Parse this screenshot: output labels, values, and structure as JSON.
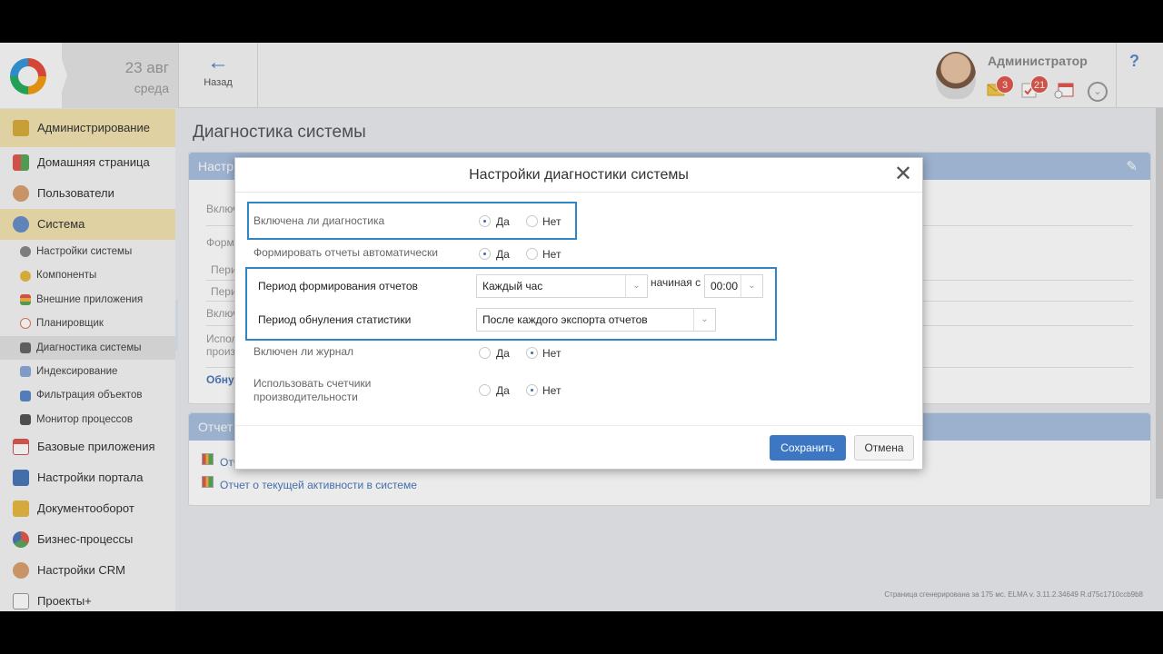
{
  "header": {
    "date_day": "23 авг",
    "date_weekday": "среда",
    "back_label": "Назад",
    "user_name": "Администратор",
    "mail_count": "3",
    "tasks_count": "21",
    "help_label": "?"
  },
  "sidebar": {
    "sections": [
      {
        "label": "Администрирование",
        "icon": "lock-icon"
      },
      {
        "label": "Домашняя страница",
        "icon": "home-icon"
      },
      {
        "label": "Пользователи",
        "icon": "users-icon"
      },
      {
        "label": "Система",
        "icon": "system-icon"
      }
    ],
    "sub_items": [
      {
        "label": "Настройки системы",
        "icon": "gear-icon"
      },
      {
        "label": "Компоненты",
        "icon": "component-icon"
      },
      {
        "label": "Внешние приложения",
        "icon": "apps-icon"
      },
      {
        "label": "Планировщик",
        "icon": "clock-icon"
      },
      {
        "label": "Диагностика системы",
        "icon": "diagnostics-icon"
      },
      {
        "label": "Индексирование",
        "icon": "index-icon"
      },
      {
        "label": "Фильтрация объектов",
        "icon": "filter-icon"
      },
      {
        "label": "Монитор процессов",
        "icon": "monitor-icon"
      }
    ],
    "bottom_items": [
      {
        "label": "Базовые приложения",
        "icon": "calendar-icon"
      },
      {
        "label": "Настройки портала",
        "icon": "portal-icon"
      },
      {
        "label": "Документооборот",
        "icon": "documents-icon"
      },
      {
        "label": "Бизнес-процессы",
        "icon": "process-icon"
      },
      {
        "label": "Настройки CRM",
        "icon": "crm-icon"
      },
      {
        "label": "Проекты+",
        "icon": "projects-icon"
      }
    ]
  },
  "main": {
    "page_title": "Диагностика системы",
    "panel1_head": "Настр",
    "panel2_head": "Отчет",
    "bg_labels": [
      "Включ",
      "Форми",
      "Перио",
      "Перио",
      "Включ",
      "Испол",
      "произ"
    ],
    "bg_link": "Обнул",
    "report_link_1": "Отч",
    "report_link_2": "Отчет о текущей активности в системе",
    "footer": "Страница сгенерирована за 175 мс. ELMA v. 3.11.2.34649 R.d75c1710ccb9b8"
  },
  "modal": {
    "title": "Настройки диагностики системы",
    "close_label": "✕",
    "yes": "Да",
    "no": "Нет",
    "rows": {
      "diag_enabled": "Включена ли диагностика",
      "auto_reports": "Формировать отчеты автоматически",
      "report_period": "Период формирования отчетов",
      "reset_period": "Период обнуления статистики",
      "journal_enabled": "Включен ли журнал",
      "perf_counters": "Использовать счетчики производительности"
    },
    "report_period_value": "Каждый час",
    "starting_from": "начиная с",
    "time_value": "00:00",
    "reset_period_value": "После каждого экспорта отчетов",
    "save_label": "Сохранить",
    "cancel_label": "Отмена",
    "selections": {
      "diag_enabled": "yes",
      "auto_reports": "yes",
      "journal_enabled": "no",
      "perf_counters": "no"
    }
  }
}
